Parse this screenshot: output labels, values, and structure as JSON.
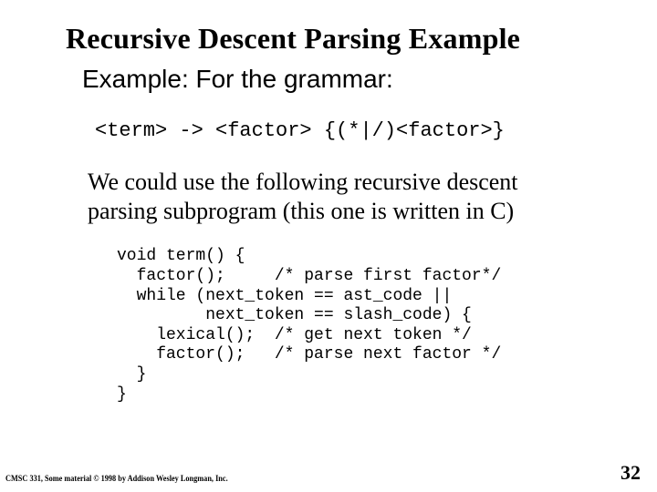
{
  "title": "Recursive Descent Parsing Example",
  "subtitle": "Example: For the grammar:",
  "grammar": "<term> -> <factor> {(*|/)<factor>}",
  "body": "We could use the following recursive descent parsing subprogram (this one is written in C)",
  "code": "void term() {\n  factor();     /* parse first factor*/\n  while (next_token == ast_code ||\n         next_token == slash_code) {\n    lexical();  /* get next token */\n    factor();   /* parse next factor */\n  }\n}",
  "footer_left": "CMSC 331, Some material © 1998 by Addison Wesley Longman, Inc.",
  "page_number": "32"
}
